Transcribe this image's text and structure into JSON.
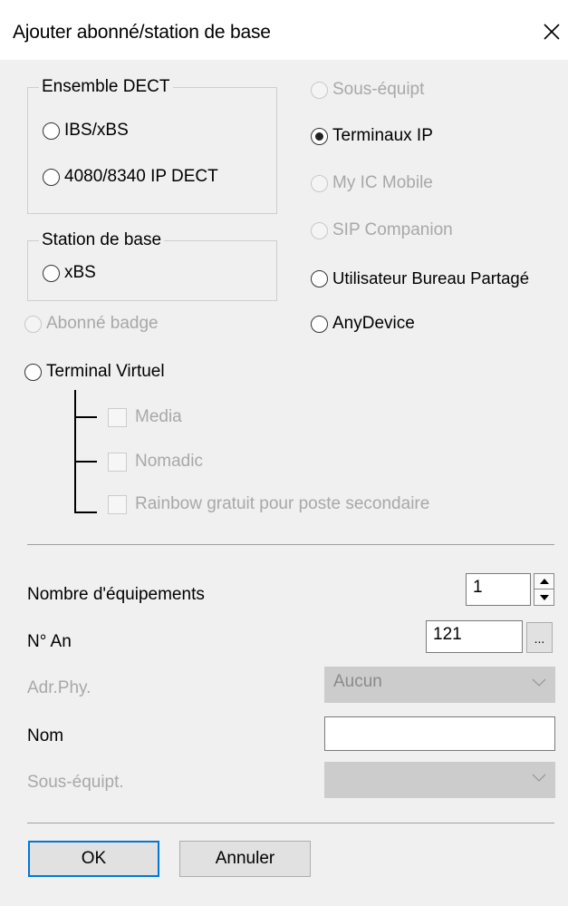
{
  "window": {
    "title": "Ajouter abonné/station de base"
  },
  "dect_group": {
    "legend": "Ensemble DECT",
    "options": [
      {
        "label": "IBS/xBS",
        "checked": false,
        "enabled": true
      },
      {
        "label": "4080/8340 IP DECT",
        "checked": false,
        "enabled": true
      }
    ]
  },
  "base_station_group": {
    "legend": "Station de base",
    "options": [
      {
        "label": "xBS",
        "checked": false,
        "enabled": true
      }
    ]
  },
  "left_options": [
    {
      "label": "Abonné badge",
      "checked": false,
      "enabled": false
    },
    {
      "label": "Terminal Virtuel",
      "checked": false,
      "enabled": true
    }
  ],
  "virtual_terminal_checks": [
    {
      "label": "Media",
      "checked": false,
      "enabled": false
    },
    {
      "label": "Nomadic",
      "checked": false,
      "enabled": false
    },
    {
      "label": "Rainbow gratuit pour poste secondaire",
      "checked": false,
      "enabled": false
    }
  ],
  "right_options": [
    {
      "label": "Sous-équipt",
      "checked": false,
      "enabled": false
    },
    {
      "label": "Terminaux IP",
      "checked": true,
      "enabled": true
    },
    {
      "label": "My IC Mobile",
      "checked": false,
      "enabled": false
    },
    {
      "label": "SIP Companion",
      "checked": false,
      "enabled": false
    },
    {
      "label": "Utilisateur Bureau Partagé",
      "checked": false,
      "enabled": true
    },
    {
      "label": "AnyDevice",
      "checked": false,
      "enabled": true
    }
  ],
  "form": {
    "equipment_count": {
      "label": "Nombre d'équipements",
      "value": "1"
    },
    "an_number": {
      "label": "N° An",
      "value": "121",
      "browse_label": "..."
    },
    "phys_address": {
      "label": "Adr.Phy.",
      "value": "Aucun",
      "enabled": false
    },
    "name": {
      "label": "Nom",
      "value": ""
    },
    "sub_equipment": {
      "label": "Sous-équipt.",
      "value": "",
      "enabled": false
    }
  },
  "buttons": {
    "ok": "OK",
    "cancel": "Annuler"
  },
  "icons": {
    "close": "close-icon",
    "spin_up": "arrow-up-icon",
    "spin_down": "arrow-down-icon",
    "dropdown": "chevron-down-icon"
  },
  "colors": {
    "focus_border": "#0078d7",
    "disabled_text": "#a8a8a8",
    "dialog_bg": "#f0f0f0"
  }
}
